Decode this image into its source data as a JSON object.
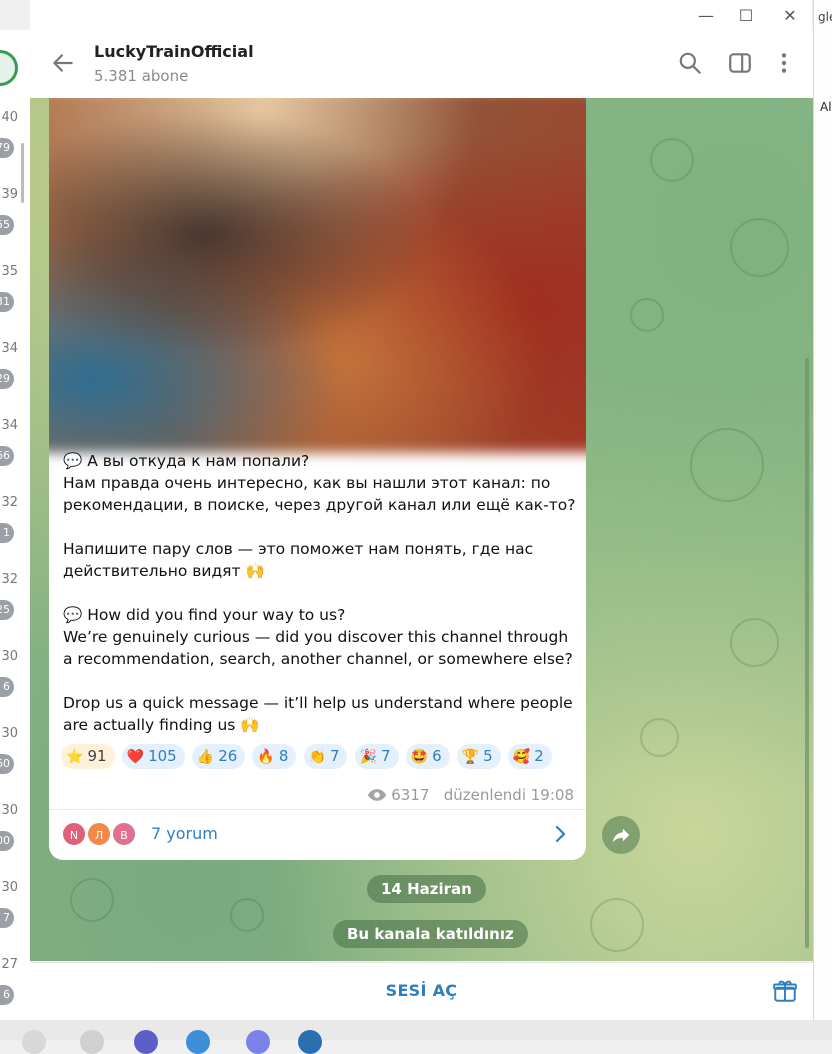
{
  "window": {
    "minimize_glyph": "—",
    "maximize_glyph": "☐",
    "close_glyph": "✕",
    "right_edge_text_top": "gle",
    "right_edge_text_mid": "Al"
  },
  "chat_list": {
    "numbers": [
      "40",
      "39",
      "35",
      "34",
      "34",
      "32",
      "32",
      "30",
      "30",
      "30",
      "30",
      "27"
    ],
    "badges": [
      "79",
      "55",
      "31",
      "29",
      "66",
      "1",
      "25",
      "6",
      "60",
      "00",
      "7",
      "6"
    ]
  },
  "header": {
    "title": "LuckyTrainOfficial",
    "subtitle": "5.381 abone",
    "icons": [
      "back-arrow-icon",
      "search-icon",
      "sidebar-toggle-icon",
      "more-vertical-icon"
    ]
  },
  "message": {
    "text": "💬 А вы откуда к нам попали?\nНам правда очень интересно, как вы нашли этот канал: по рекомендации, в поиске, через другой канал или ещё как-то?\n\nНапишите пару слов — это поможет нам понять, где нас действительно видят 🙌\n\n💬 How did you find your way to us?\nWe’re genuinely curious — did you discover this channel through a recommendation, search, another channel, or somewhere else?\n\nDrop us a quick message — it’ll help us understand where people are actually finding us 🙌",
    "reactions": [
      {
        "emoji": "⭐",
        "count": "91"
      },
      {
        "emoji": "❤️",
        "count": "105"
      },
      {
        "emoji": "👍",
        "count": "26"
      },
      {
        "emoji": "🔥",
        "count": "8"
      },
      {
        "emoji": "👏",
        "count": "7"
      },
      {
        "emoji": "🎉",
        "count": "7"
      },
      {
        "emoji": "🤩",
        "count": "6"
      },
      {
        "emoji": "🏆",
        "count": "5"
      },
      {
        "emoji": "🥰",
        "count": "2"
      }
    ],
    "views": "6317",
    "edited_time": "düzenlendi 19:08",
    "comment_avatars": [
      "N",
      "Л",
      "B"
    ],
    "comment_avatar_colors": [
      "#e0607a",
      "#f0894a",
      "#e07090"
    ],
    "comments_label": "7 yorum"
  },
  "service": {
    "date": "14 Haziran",
    "joined": "Bu kanala katıldınız"
  },
  "bottom": {
    "unmute_label": "SESİ AÇ",
    "gift_icon": "gift-icon"
  },
  "colors": {
    "accent": "#2f7fc0",
    "chat_bg": "#8fb887"
  }
}
